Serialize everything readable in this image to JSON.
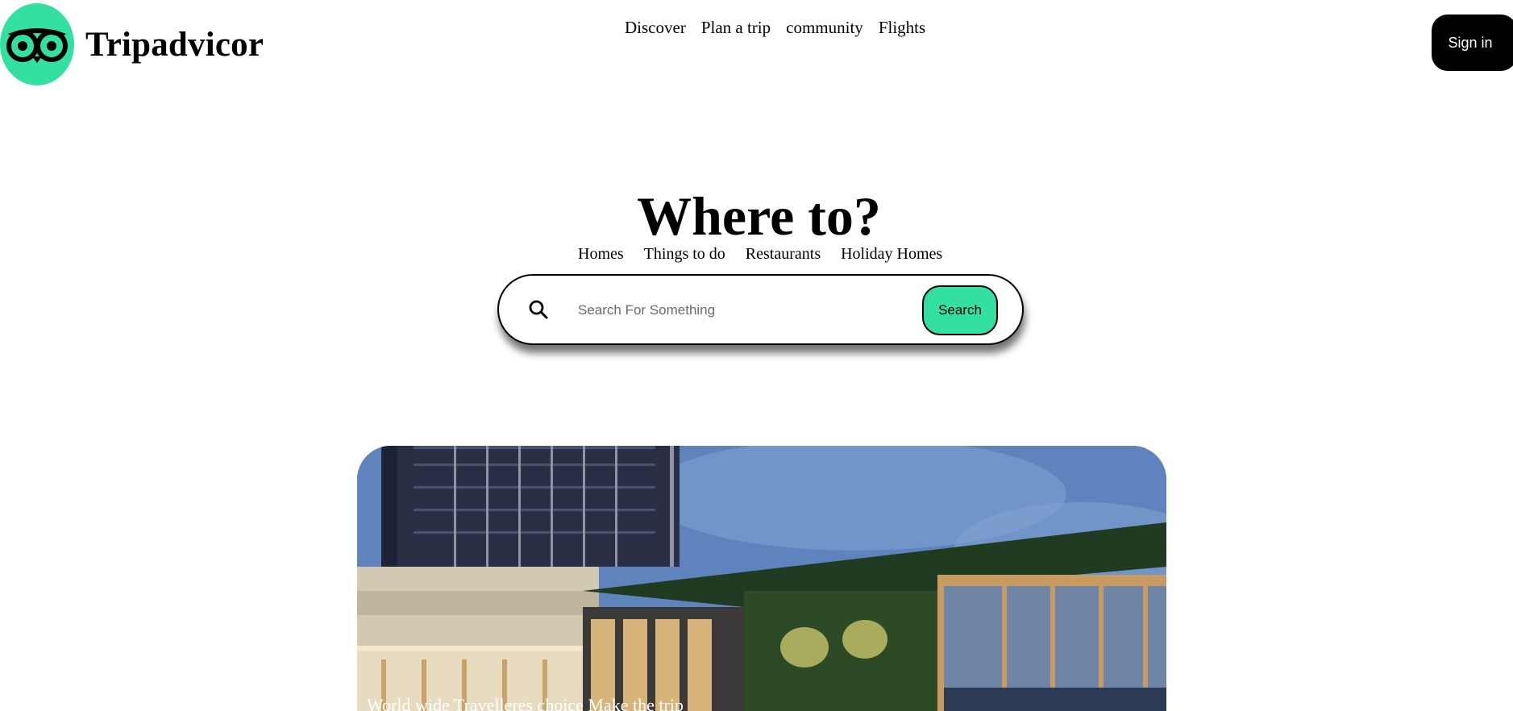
{
  "brand": {
    "name": "Tripadvicor",
    "logo_icon": "owl-eyes-icon",
    "logo_color": "#34e0a1"
  },
  "top_nav": {
    "items": [
      "Discover",
      "Plan a trip",
      "community",
      "Flights"
    ]
  },
  "header": {
    "signin_label": "Sign in"
  },
  "hero": {
    "title": "Where to?",
    "tabs": [
      "Homes",
      "Things to do",
      "Restaurants",
      "Holiday Homes"
    ]
  },
  "search": {
    "placeholder": "Search For Something",
    "value": "",
    "button_label": "Search",
    "icon": "search-icon",
    "button_color": "#34e0a1"
  },
  "feature": {
    "caption": "World wide Travelleres choice Make the trip"
  }
}
